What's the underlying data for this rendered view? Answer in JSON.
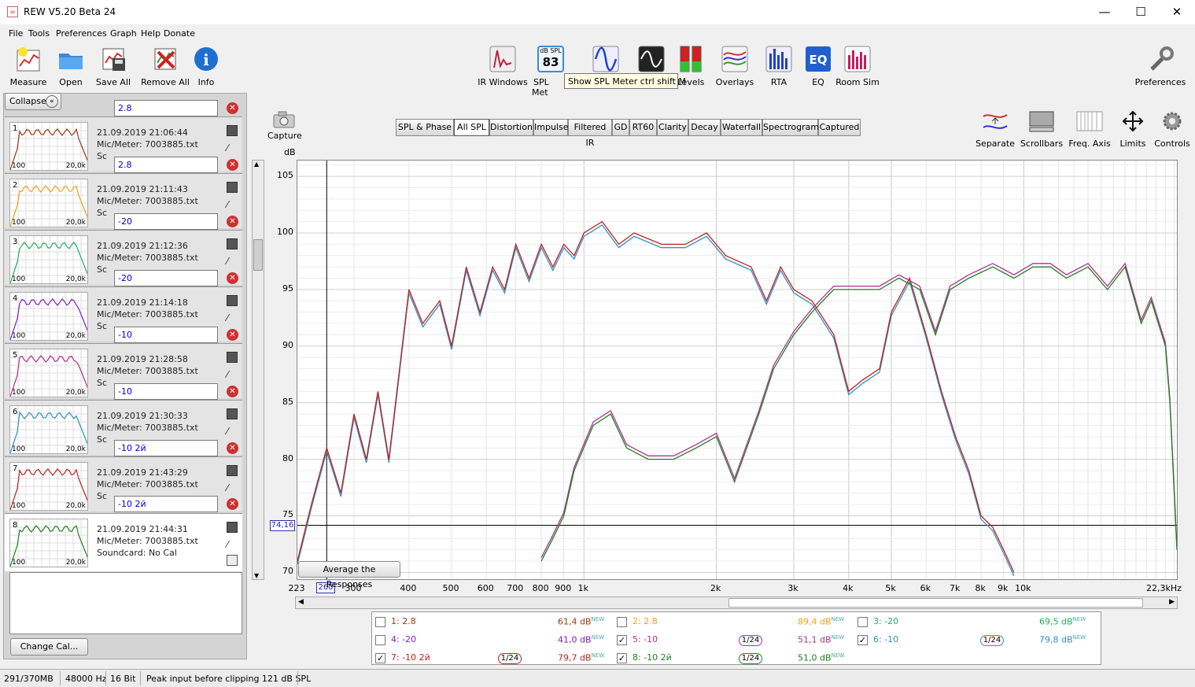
{
  "window": {
    "title": "REW V5.20 Beta 24"
  },
  "menu": [
    "File",
    "Tools",
    "Preferences",
    "Graph",
    "Help",
    "Donate"
  ],
  "toolbar_left": [
    {
      "label": "Measure",
      "icon": "measure-icon"
    },
    {
      "label": "Open",
      "icon": "folder-icon"
    },
    {
      "label": "Save All",
      "icon": "save-all-icon"
    },
    {
      "label": "Remove All",
      "icon": "remove-all-icon"
    },
    {
      "label": "Info",
      "icon": "info-icon"
    }
  ],
  "toolbar_center": [
    {
      "label": "IR Windows",
      "icon": "ir-windows-icon"
    },
    {
      "label": "SPL Met",
      "icon": "spl-meter-icon",
      "readout": "83",
      "unit": "dB SPL"
    },
    {
      "label": "Generator",
      "icon": "generator-icon"
    },
    {
      "label": "Scope",
      "icon": "scope-icon"
    },
    {
      "label": "Levels",
      "icon": "levels-icon"
    },
    {
      "label": "Overlays",
      "icon": "overlays-icon"
    },
    {
      "label": "RTA",
      "icon": "rta-icon"
    },
    {
      "label": "EQ",
      "icon": "eq-icon"
    },
    {
      "label": "Room Sim",
      "icon": "room-sim-icon"
    }
  ],
  "tooltip": "Show SPL Meter  ctrl shift M",
  "preferences_label": "Preferences",
  "collapse_label": "Collapse",
  "measurements": [
    {
      "n": "1",
      "name": "2.8",
      "date": "21.09.2019 21:06:44",
      "mic": "Mic/Meter: 7003885.txt",
      "sc": "Sc",
      "color": "#9a3a10",
      "x0": "100",
      "x1": "20,0k"
    },
    {
      "n": "2",
      "name": "2.8",
      "date": "21.09.2019 21:11:43",
      "mic": "Mic/Meter: 7003885.txt",
      "sc": "Sc",
      "color": "#f0a020",
      "x0": "100",
      "x1": "20,0k"
    },
    {
      "n": "3",
      "name": "-20",
      "date": "21.09.2019 21:12:36",
      "mic": "Mic/Meter: 7003885.txt",
      "sc": "Sc",
      "color": "#20b060",
      "x0": "100",
      "x1": "20,0k"
    },
    {
      "n": "4",
      "name": "-20",
      "date": "21.09.2019 21:14:18",
      "mic": "Mic/Meter: 7003885.txt",
      "sc": "Sc",
      "color": "#8020c0",
      "x0": "100",
      "x1": "20,0k"
    },
    {
      "n": "5",
      "name": "-10",
      "date": "21.09.2019 21:28:58",
      "mic": "Mic/Meter: 7003885.txt",
      "sc": "Sc",
      "color": "#b03090",
      "x0": "100",
      "x1": "20,0k"
    },
    {
      "n": "6",
      "name": "-10",
      "date": "21.09.2019 21:30:33",
      "mic": "Mic/Meter: 7003885.txt",
      "sc": "Sc",
      "color": "#3090c0",
      "x0": "100",
      "x1": "20,0k"
    },
    {
      "n": "7",
      "name": "-10 2й",
      "date": "21.09.2019 21:43:29",
      "mic": "Mic/Meter: 7003885.txt",
      "sc": "Sc",
      "color": "#c02020",
      "x0": "100",
      "x1": "20,0k"
    },
    {
      "n": "8",
      "name": "-10 2й",
      "date": "21.09.2019 21:44:31",
      "mic": "Mic/Meter: 7003885.txt",
      "sc": "Soundcard: No Cal",
      "color": "#208020",
      "x0": "100",
      "x1": "20,0k"
    }
  ],
  "change_cal_label": "Change Cal...",
  "capture_label": "Capture",
  "tabs": [
    "SPL & Phase",
    "All SPL",
    "Distortion",
    "Impulse",
    "Filtered IR",
    "GD",
    "RT60",
    "Clarity",
    "Decay",
    "Waterfall",
    "Spectrogram",
    "Captured"
  ],
  "active_tab": "All SPL",
  "graph_tools": [
    {
      "label": "Separate",
      "icon": "separate-icon"
    },
    {
      "label": "Scrollbars",
      "icon": "scrollbars-icon"
    },
    {
      "label": "Freq. Axis",
      "icon": "freq-axis-icon"
    },
    {
      "label": "Limits",
      "icon": "limits-icon"
    },
    {
      "label": "Controls",
      "icon": "controls-icon"
    }
  ],
  "y_unit": "dB",
  "y_ticks": [
    "105",
    "100",
    "95",
    "90",
    "85",
    "80",
    "75",
    "70"
  ],
  "x_ticks": [
    "223",
    "260",
    "300",
    "400",
    "500",
    "600",
    "700",
    "800",
    "900",
    "1k",
    "2k",
    "3k",
    "4k",
    "5k",
    "6k",
    "7k",
    "8k",
    "9k",
    "10k",
    "22,3kHz"
  ],
  "cursor": {
    "y_label": "74,16",
    "x_label": "260"
  },
  "average_button": "Average the Responses",
  "legend": [
    {
      "label": "1: 2.8",
      "value": "61,4 dB",
      "new": "NEW",
      "checked": false,
      "color": "#9a3a10",
      "smooth": ""
    },
    {
      "label": "2: 2.8",
      "value": "89,4 dB",
      "new": "NEW",
      "checked": false,
      "color": "#f0a020",
      "smooth": ""
    },
    {
      "label": "3: -20",
      "value": "69,5 dB",
      "new": "NEW",
      "checked": false,
      "color": "#20b060",
      "smooth": ""
    },
    {
      "label": "4: -20",
      "value": "41,0 dB",
      "new": "NEW",
      "checked": false,
      "color": "#8020c0",
      "smooth": ""
    },
    {
      "label": "5: -10",
      "value": "51,1 dB",
      "new": "NEW",
      "checked": true,
      "color": "#b03090",
      "smooth": "1/24"
    },
    {
      "label": "6: -10",
      "value": "79,8 dB",
      "new": "NEW",
      "checked": true,
      "color": "#3090c0",
      "smooth": "1/24"
    },
    {
      "label": "7: -10 2й",
      "value": "79,7 dB",
      "new": "NEW",
      "checked": true,
      "color": "#c02020",
      "smooth": "1/24"
    },
    {
      "label": "8: -10 2й",
      "value": "51,0 dB",
      "new": "NEW",
      "checked": true,
      "color": "#208020",
      "smooth": "1/24"
    }
  ],
  "status": [
    "291/370MB",
    "48000 Hz",
    "16 Bit",
    "Peak input before clipping 121 dB SPL"
  ],
  "colors": {
    "accent": "#0066cc"
  }
}
